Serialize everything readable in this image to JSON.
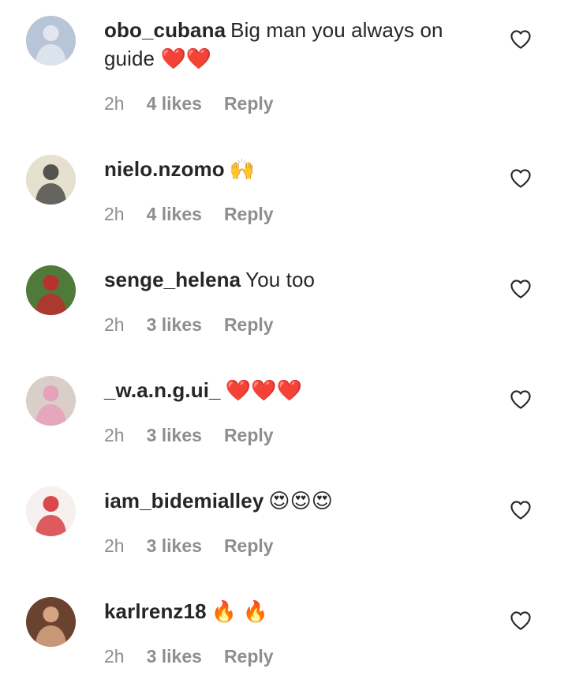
{
  "comments": [
    {
      "username": "obo_cubana",
      "text": "Big man you always on guide ❤️❤️",
      "time": "2h",
      "likes": "4 likes",
      "reply": "Reply",
      "avatar_colors": [
        "#b8c4d8",
        "#e9edf3"
      ]
    },
    {
      "username": "nielo.nzomo",
      "text": "🙌",
      "time": "2h",
      "likes": "4 likes",
      "reply": "Reply",
      "avatar_colors": [
        "#e6e1cf",
        "#3a3a3a"
      ]
    },
    {
      "username": "senge_helena",
      "text": "You too",
      "time": "2h",
      "likes": "3 likes",
      "reply": "Reply",
      "avatar_colors": [
        "#4f7a3a",
        "#c8262b"
      ]
    },
    {
      "username": "_w.a.n.g.ui_",
      "text": "❤️❤️❤️",
      "time": "2h",
      "likes": "3 likes",
      "reply": "Reply",
      "avatar_colors": [
        "#d9cfc8",
        "#e79ab8"
      ]
    },
    {
      "username": "iam_bidemialley",
      "text": "😍😍😍",
      "time": "2h",
      "likes": "3 likes",
      "reply": "Reply",
      "avatar_colors": [
        "#f6f0ee",
        "#d42a2f"
      ]
    },
    {
      "username": "karlrenz18",
      "text": "🔥 🔥",
      "time": "2h",
      "likes": "3 likes",
      "reply": "Reply",
      "avatar_colors": [
        "#6a4230",
        "#e8b48f"
      ]
    }
  ],
  "icons": {
    "like": "heart-outline-icon"
  }
}
